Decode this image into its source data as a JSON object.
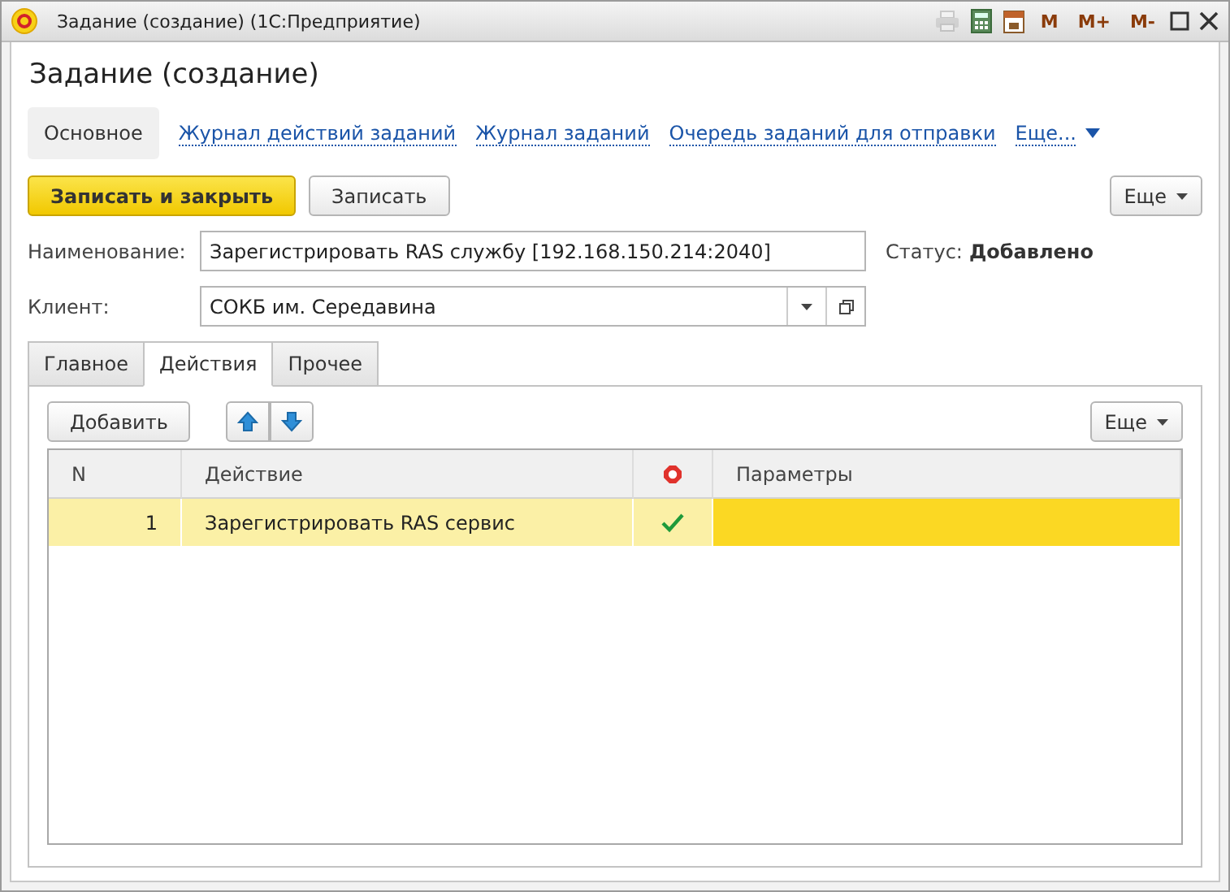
{
  "window": {
    "title": "Задание (создание)  (1С:Предприятие)",
    "memory_buttons": [
      "M",
      "M+",
      "M-"
    ],
    "print_disabled": true
  },
  "form": {
    "title": "Задание (создание)"
  },
  "nav": [
    {
      "label": "Основное",
      "selected": true
    },
    {
      "label": "Журнал действий заданий",
      "selected": false
    },
    {
      "label": "Журнал заданий",
      "selected": false
    },
    {
      "label": "Очередь заданий для отправки",
      "selected": false
    }
  ],
  "nav_more": "Еще...",
  "toolbar": {
    "primary": "Записать и закрыть",
    "secondary": "Записать",
    "more": "Еще"
  },
  "fields": {
    "name_label": "Наименование:",
    "name_value": "Зарегистрировать RAS службу [192.168.150.214:2040]",
    "status_label": "Статус:",
    "status_value": "Добавлено",
    "client_label": "Клиент:",
    "client_value": "СОКБ им. Середавина"
  },
  "tabs": [
    {
      "label": "Главное",
      "selected": false
    },
    {
      "label": "Действия",
      "selected": true
    },
    {
      "label": "Прочее",
      "selected": false
    }
  ],
  "table_toolbar": {
    "add": "Добавить",
    "more": "Еще"
  },
  "table": {
    "columns": [
      "N",
      "Действие",
      "Параметры"
    ],
    "rows": [
      {
        "n": "1",
        "action": "Зарегистрировать RAS сервис",
        "done": true,
        "selected": true
      }
    ]
  }
}
